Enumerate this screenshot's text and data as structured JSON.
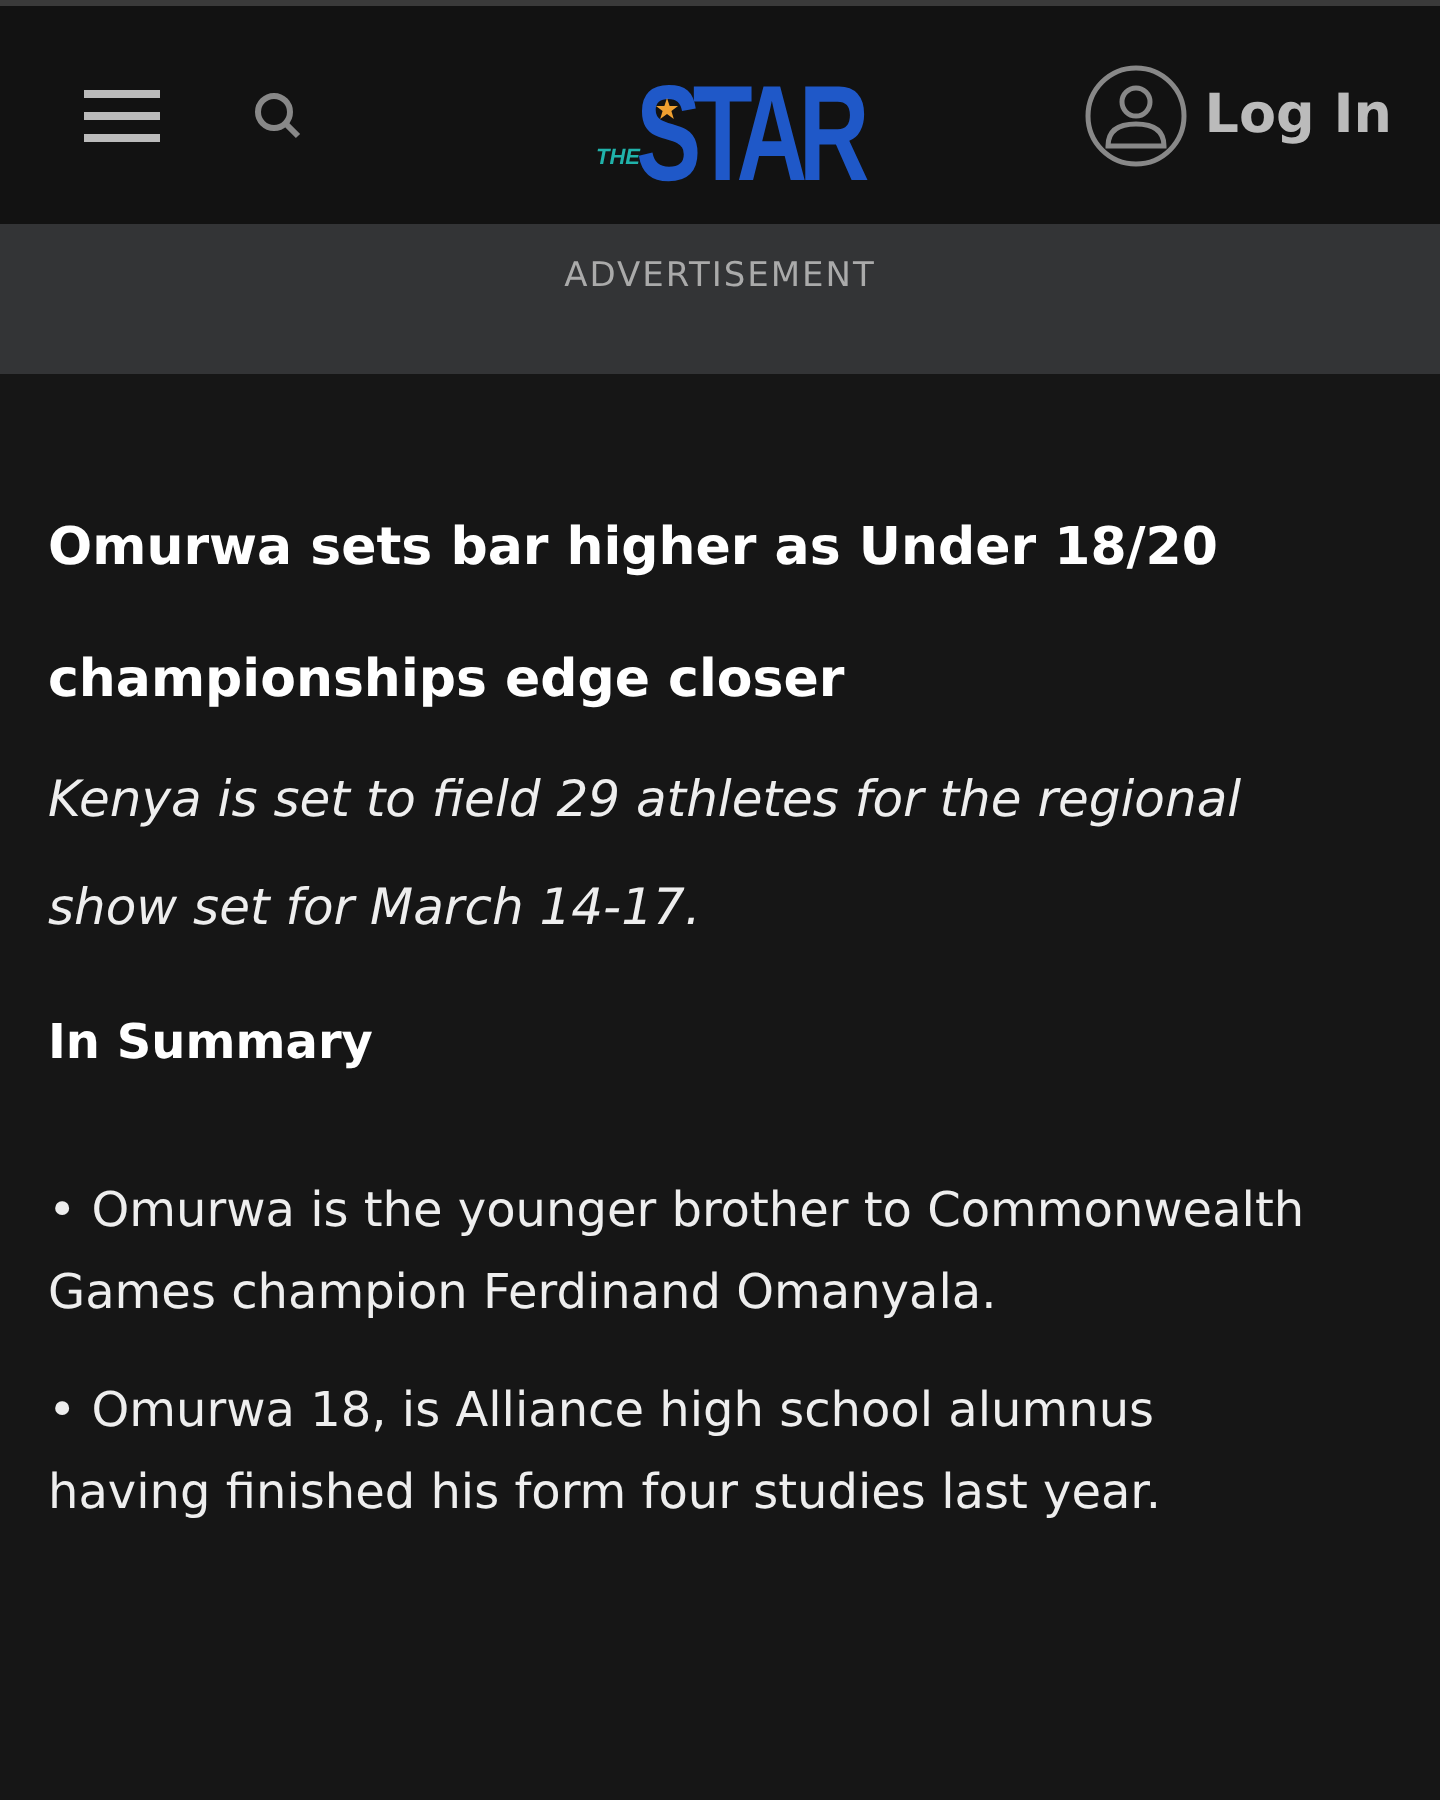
{
  "header": {
    "logo": {
      "small": "THE",
      "main": "STAR"
    },
    "login": "Log In"
  },
  "advertisement": "ADVERTISEMENT",
  "article": {
    "headline": "Omurwa sets bar higher as Under 18/20 championships edge closer",
    "standfirst": "Kenya is set to field 29 athletes for the regional show set for March 14-17.",
    "summary_title": "In Summary",
    "summary": [
      "• Omurwa is the younger brother to Commonwealth Games champion Ferdinand Omanyala.",
      "• Omurwa 18, is Alliance high school alumnus having finished his form four studies last year."
    ]
  }
}
